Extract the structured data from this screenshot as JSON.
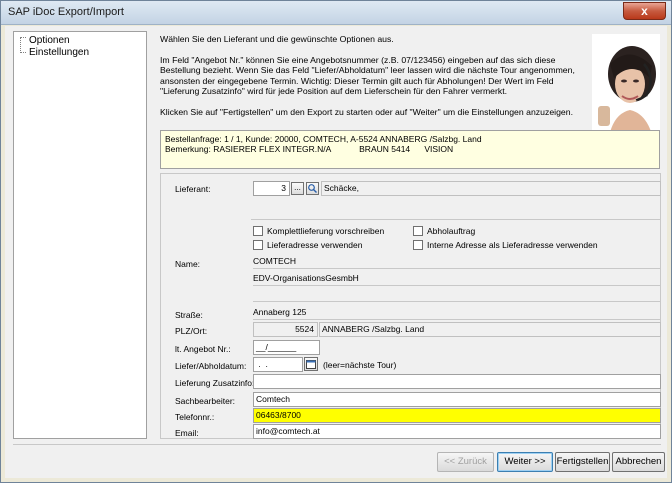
{
  "window": {
    "title": "SAP iDoc Export/Import",
    "close_label": "x"
  },
  "nav": {
    "items": [
      "Optionen",
      "Einstellungen"
    ]
  },
  "description": {
    "p1": "Wählen Sie den Lieferant und die gewünschte Optionen aus.",
    "p2": "Im Feld \"Angebot Nr.\" können Sie eine Angebotsnummer (z.B. 07/123456) eingeben auf das sich diese Bestellung bezieht. Wenn Sie das Feld \"Liefer/Abholdatum\" leer lassen wird die nächste Tour angenommen, ansonsten der eingegebene Termin. Wichtig: Dieser Termin gilt auch für Abholungen! Der Wert im Feld \"Lieferung Zusatzinfo\" wird für jede Position auf dem Lieferschein für den Fahrer vermerkt.",
    "p3": "Klicken Sie auf \"Fertigstellen\" um den Export zu starten oder auf \"Weiter\" um die Einstellungen anzuzeigen."
  },
  "info": {
    "line1": "Bestellanfrage: 1 / 1, Kunde: 20000, COMTECH, A-5524 ANNABERG /Salzbg. Land",
    "line2": "Bemerkung: RASIERER FLEX INTEGR.N/A            BRAUN 5414      VISION"
  },
  "form": {
    "lieferant_label": "Lieferant:",
    "lieferant_num": "3",
    "lieferant_btn1": "...",
    "lieferant_name": "Schäcke,",
    "chk_komplett": "Komplettlieferung vorschreiben",
    "chk_abhol": "Abholauftrag",
    "chk_lieferadr": "Lieferadresse verwenden",
    "chk_intern": "Interne Adresse als Lieferadresse verwenden",
    "name_label": "Name:",
    "name1": "COMTECH",
    "name2": "EDV-OrganisationsGesmbH",
    "name3": "",
    "strasse_label": "Straße:",
    "strasse": "Annaberg 125",
    "plz_label": "PLZ/Ort:",
    "plz": "5524",
    "ort": "ANNABERG /Salzbg. Land",
    "angebot_label": "lt. Angebot Nr.:",
    "angebot": "__/______",
    "datum_label": "Liefer/Abholdatum:",
    "datum": " .  .",
    "datum_hint": "(leer=nächste Tour)",
    "zusatz_label": "Lieferung Zusatzinfo:",
    "zusatz": "",
    "sachb_label": "Sachbearbeiter:",
    "sachb": "Comtech",
    "tel_label": "Telefonnr.:",
    "tel": "06463/8700",
    "email_label": "Email:",
    "email": "info@comtech.at"
  },
  "buttons": {
    "back": "<< Zurück",
    "next": "Weiter >>",
    "finish": "Fertigstellen",
    "cancel": "Abbrechen"
  },
  "colors": {
    "info_bg": "#ffffe1",
    "highlight": "#ffff00"
  }
}
